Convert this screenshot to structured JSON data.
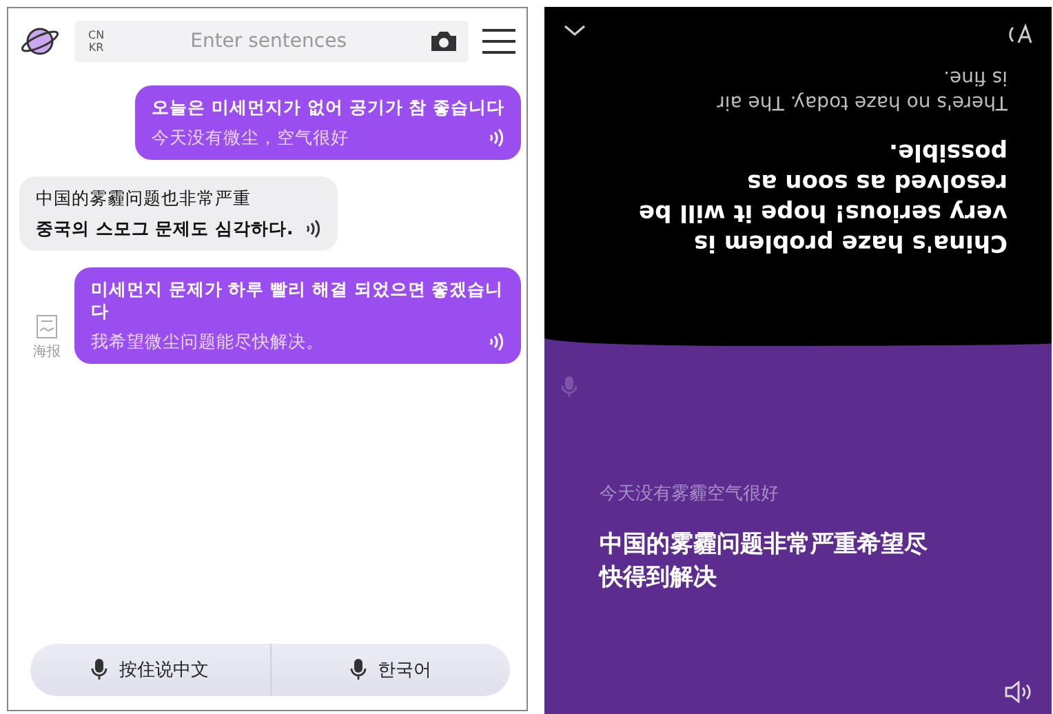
{
  "translator": {
    "search": {
      "lang_from": "CN",
      "lang_to": "KR",
      "placeholder": "Enter sentences"
    },
    "messages": [
      {
        "kind": "sent",
        "text": "오늘은 미세먼지가 없어 공기가 참 좋습니다",
        "subtext": "今天没有微尘，空气很好"
      },
      {
        "kind": "received",
        "text": "中国的雾霾问题也非常严重",
        "subtext": "중국의 스모그 문제도 심각하다."
      },
      {
        "kind": "sent",
        "text": "미세먼지 문제가 하루 빨리 해결 되었으면 좋겠습니다",
        "subtext": "我希望微尘问题能尽快解决。"
      }
    ],
    "poster": {
      "label": "海报"
    },
    "voice_buttons": [
      {
        "label": "按住说中文"
      },
      {
        "label": "한국어"
      }
    ]
  },
  "conversation": {
    "flipped": [
      {
        "kind": "previous",
        "lines": [
          "There's no haze today. The air",
          "is fine."
        ]
      },
      {
        "kind": "current",
        "lines": [
          "China's haze problem is",
          "very serious! hope it will be",
          "resolved as soon as",
          "possible."
        ]
      }
    ],
    "history": "今天没有雾霾空气很好",
    "current": [
      "中国的雾霾问题非常严重希望尽",
      "快得到解决"
    ]
  }
}
